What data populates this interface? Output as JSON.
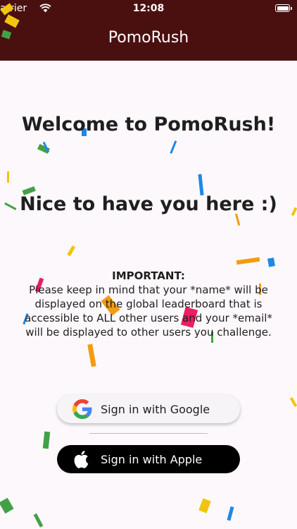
{
  "status_bar": {
    "carrier": "arrier",
    "time": "12:08"
  },
  "app_bar": {
    "title": "PomoRush"
  },
  "welcome": {
    "title": "Welcome to PomoRush!",
    "subtitle": "Nice to have you here :)"
  },
  "notice": {
    "label": "IMPORTANT:",
    "text": "Please keep in mind that your *name* will be displayed on the global leaderboard that is accessible to ALL other users and your *email* will be displayed to other users you challenge."
  },
  "auth": {
    "google_label": "Sign in with Google",
    "apple_label": "Sign in with Apple"
  },
  "colors": {
    "app_bar": "#4a1010",
    "background": "#fdf8fb",
    "google_button": "#f6f4f6",
    "apple_button": "#000000"
  },
  "icons": {
    "google": "google-g-icon",
    "apple": "apple-logo-icon",
    "wifi": "wifi-icon",
    "battery": "battery-icon"
  }
}
